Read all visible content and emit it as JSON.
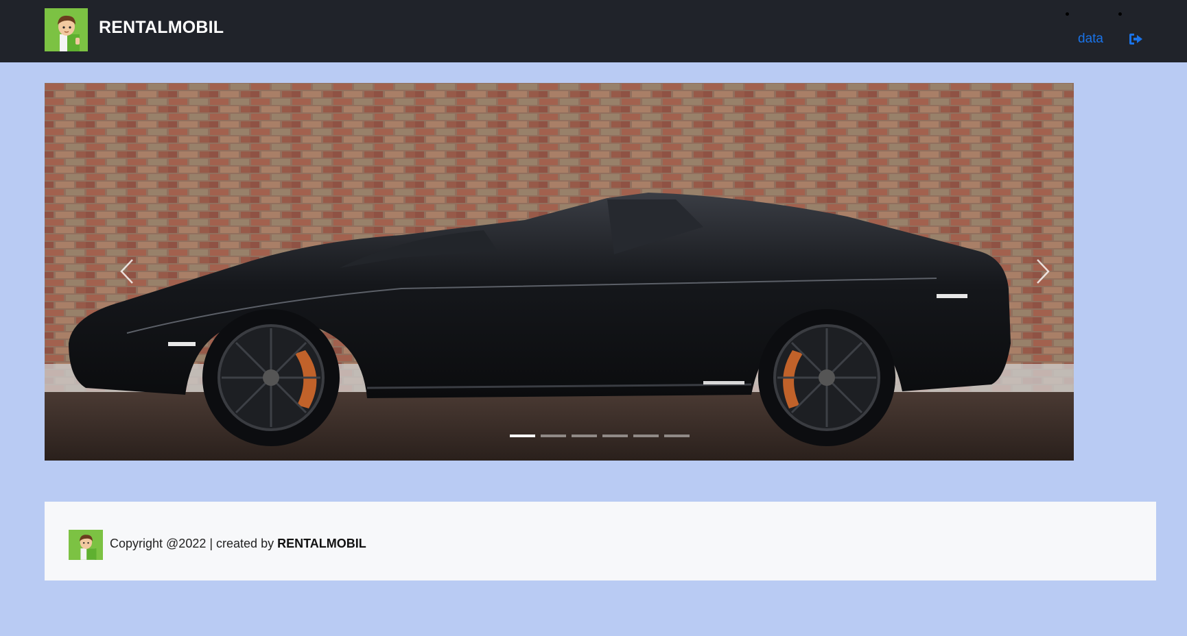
{
  "navbar": {
    "brand": "RENTALMOBIL",
    "logo_icon": "boy-avatar-icon",
    "link_label": "data",
    "logout_icon": "sign-out-icon",
    "link_color": "#1a73e8"
  },
  "carousel": {
    "slide_image": "black-convertible-sports-car-photo",
    "prev_icon": "chevron-left-icon",
    "next_icon": "chevron-right-icon",
    "slide_count": 6,
    "active_slide": 1
  },
  "footer": {
    "copyright": "Copyright @2022 | created by ",
    "brand": "RENTALMOBIL",
    "logo_icon": "boy-avatar-icon"
  },
  "colors": {
    "page_bg": "#b9cbf3",
    "navbar_bg": "#20232a",
    "footer_bg": "#f7f8fa",
    "logo_bg": "#7cc243"
  }
}
